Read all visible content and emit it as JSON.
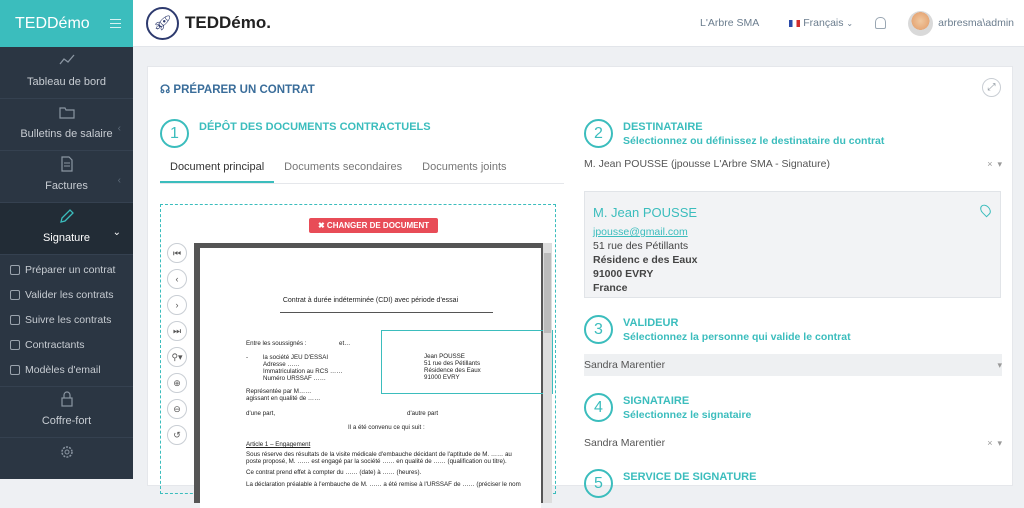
{
  "sidebar": {
    "brand": "TEDDémo",
    "items": [
      {
        "label": "Tableau de bord"
      },
      {
        "label": "Bulletins de salaire"
      },
      {
        "label": "Factures"
      },
      {
        "label": "Signature"
      }
    ],
    "sub": [
      "Préparer un contrat",
      "Valider les contrats",
      "Suivre les contrats",
      "Contractants",
      "Modèles d'email"
    ],
    "bottom": [
      "Coffre-fort"
    ]
  },
  "topbar": {
    "logo": "TEDDémo.",
    "org": "L'Arbre SMA",
    "lang": "Français",
    "user": "arbresma\\admin"
  },
  "panel": {
    "title": "PRÉPARER UN CONTRAT"
  },
  "steps": [
    {
      "num": "1",
      "title": "DÉPÔT DES DOCUMENTS CONTRACTUELS"
    },
    {
      "num": "2",
      "title": "DESTINATAIRE",
      "sub": "Sélectionnez ou définissez le destinataire du contrat"
    },
    {
      "num": "3",
      "title": "VALIDEUR",
      "sub": "Sélectionnez la personne qui valide le contrat"
    },
    {
      "num": "4",
      "title": "SIGNATAIRE",
      "sub": "Sélectionnez le signataire"
    },
    {
      "num": "5",
      "title": "SERVICE DE SIGNATURE"
    }
  ],
  "tabs": [
    "Document principal",
    "Documents secondaires",
    "Documents joints"
  ],
  "doc": {
    "changer": "✖ CHANGER DE DOCUMENT",
    "title": "Contrat à durée indéterminée (CDI) avec période d'essai",
    "lines": [
      "Entre les soussignés :",
      "et…",
      "-",
      "la société JEU D'ESSAI",
      "Adresse ……",
      "Immatriculation au RCS ……",
      "Numéro URSSAF ……",
      "Représentée par M……",
      "agissant en qualité de ……",
      "d'une part,",
      "d'autre part",
      "Il a été convenu ce qui suit :",
      "Article 1 – Engagement",
      "Sous réserve des résultats de la visite médicale d'embauche décidant de l'aptitude de M. …… au",
      "poste proposé, M. …… est engagé par la société …… en qualité de …… (qualification ou titre).",
      "Ce contrat prend effet à compter du …… (date) à …… (heures).",
      "La déclaration préalable à l'embauche de M. …… a été remise à l'URSSAF de …… (préciser le nom"
    ],
    "box": [
      "Jean POUSSE",
      "51 rue des Pétillants",
      "Résidence des Eaux",
      "91000 EVRY"
    ]
  },
  "recipient": {
    "select": "M. Jean POUSSE (jpousse L'Arbre SMA - Signature)",
    "name": "M. Jean POUSSE",
    "email": "jpousse@gmail.com",
    "addr1": "51 rue des Pétillants",
    "addr2": "Résidenc e des Eaux",
    "city": "91000 EVRY",
    "country": "France"
  },
  "validator": {
    "select": "Sandra Marentier"
  },
  "signer": {
    "select": "Sandra Marentier"
  },
  "colors": {
    "accent": "#3bbdbd",
    "sidebar": "#2b3643",
    "danger": "#e84c57"
  }
}
